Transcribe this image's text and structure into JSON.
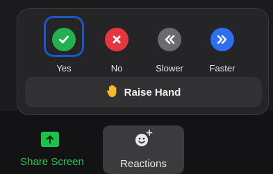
{
  "feedback": {
    "items": [
      {
        "label": "Yes",
        "icon": "checkmark-icon",
        "color": "#22b14c"
      },
      {
        "label": "No",
        "icon": "close-icon",
        "color": "#e6363d"
      },
      {
        "label": "Slower",
        "icon": "chevrons-left-icon",
        "color": "#6b6b6f"
      },
      {
        "label": "Faster",
        "icon": "chevrons-right-icon",
        "color": "#2d6ff0"
      }
    ],
    "selected": "Yes"
  },
  "raise_hand": {
    "label": "Raise Hand",
    "icon": "raised-hand-icon"
  },
  "toolbar": {
    "share_label": "Share Screen",
    "reactions_label": "Reactions"
  },
  "colors": {
    "accent_green": "#23c553",
    "selection_ring": "#1b57c9",
    "popup_bg": "#252527"
  }
}
